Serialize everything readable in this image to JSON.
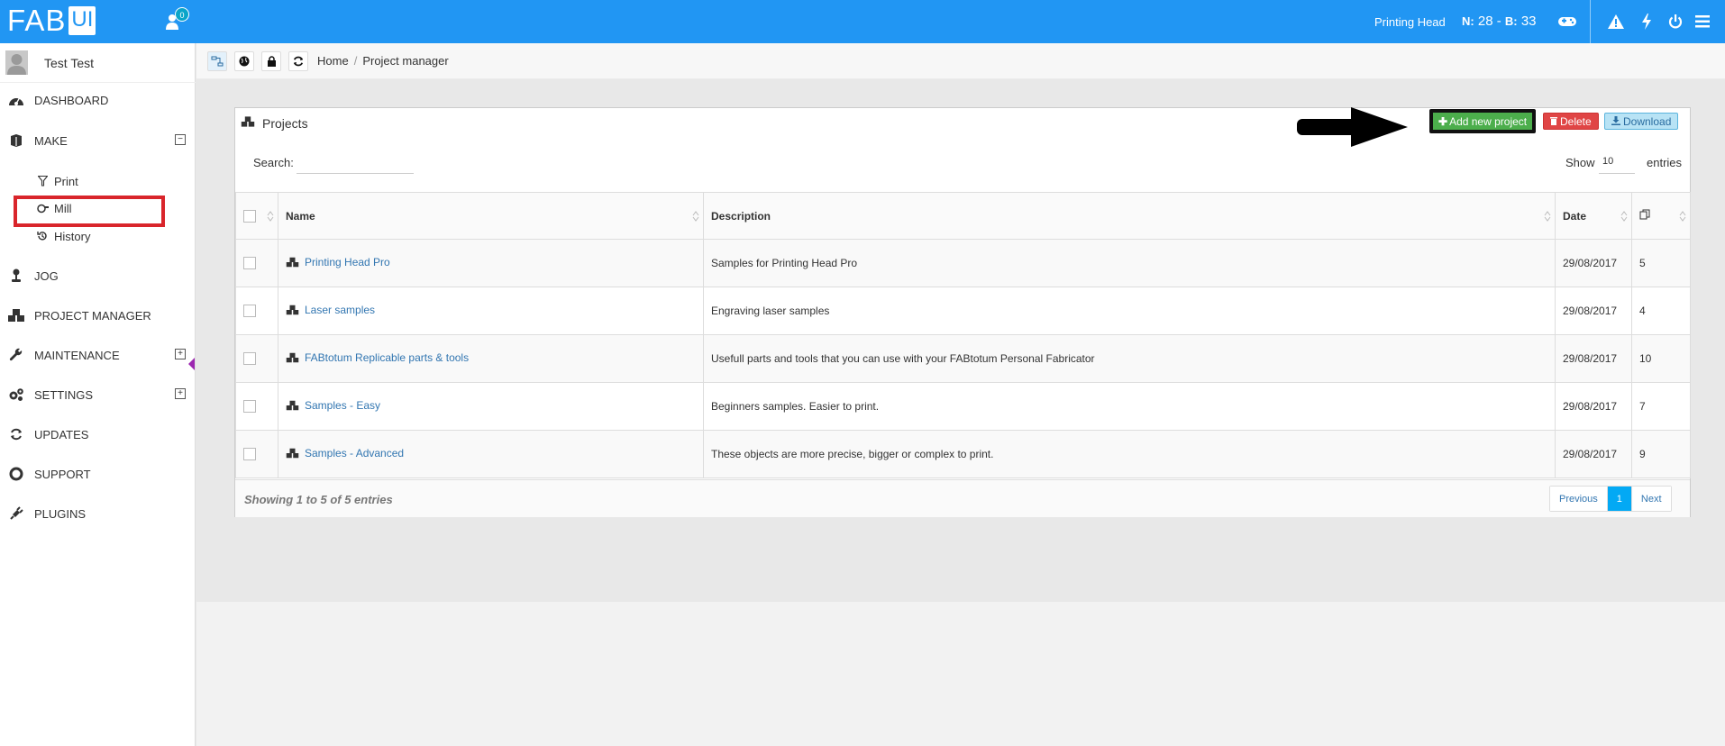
{
  "app": {
    "logo_main": "FAB",
    "logo_sub": "UI",
    "notifications_count": "0",
    "head_status": "Printing Head",
    "temps": {
      "nozzle_label": "N:",
      "nozzle_value": "28",
      "bed_sep": "-",
      "bed_label": "B:",
      "bed_value": "33"
    }
  },
  "sidebar": {
    "user_name": "Test Test",
    "items": [
      {
        "label": "DASHBOARD",
        "icon": "dashboard-icon"
      },
      {
        "label": "MAKE",
        "icon": "make-icon",
        "toggle": "−"
      },
      {
        "label": "JOG",
        "icon": "jog-icon"
      },
      {
        "label": "PROJECT MANAGER",
        "icon": "project-manager-icon"
      },
      {
        "label": "MAINTENANCE",
        "icon": "wrench-icon",
        "toggle": "+"
      },
      {
        "label": "SETTINGS",
        "icon": "gears-icon",
        "toggle": "+"
      },
      {
        "label": "UPDATES",
        "icon": "refresh-icon"
      },
      {
        "label": "SUPPORT",
        "icon": "lifebuoy-icon"
      },
      {
        "label": "PLUGINS",
        "icon": "plug-icon"
      }
    ],
    "make_sub": [
      {
        "label": "Print",
        "icon": "filter-icon"
      },
      {
        "label": "Mill",
        "icon": "mill-icon"
      },
      {
        "label": "History",
        "icon": "history-icon"
      }
    ]
  },
  "breadcrumb": {
    "home": "Home",
    "sep": "/",
    "current": "Project manager"
  },
  "panel": {
    "title": "Projects",
    "add_label": "Add new project",
    "delete_label": "Delete",
    "download_label": "Download",
    "search_label": "Search:",
    "search_value": "",
    "show_label": "Show",
    "show_value": "10",
    "entries_label": "entries",
    "columns": {
      "name": "Name",
      "description": "Description",
      "date": "Date"
    },
    "rows": [
      {
        "name": "Printing Head Pro",
        "description": "Samples for Printing Head Pro",
        "date": "29/08/2017",
        "count": "5"
      },
      {
        "name": "Laser samples",
        "description": "Engraving laser samples",
        "date": "29/08/2017",
        "count": "4"
      },
      {
        "name": "FABtotum Replicable parts & tools",
        "description": "Usefull parts and tools that you can use with your FABtotum Personal Fabricator",
        "date": "29/08/2017",
        "count": "10"
      },
      {
        "name": "Samples - Easy",
        "description": "Beginners samples. Easier to print.",
        "date": "29/08/2017",
        "count": "7"
      },
      {
        "name": "Samples - Advanced",
        "description": "These objects are more precise, bigger or complex to print.",
        "date": "29/08/2017",
        "count": "9"
      }
    ],
    "footer_info": "Showing 1 to 5 of 5 entries",
    "pager": {
      "prev": "Previous",
      "page": "1",
      "next": "Next"
    }
  },
  "colors": {
    "topbar": "#2196f3",
    "add": "#4cae4c",
    "delete": "#e04545",
    "download_bg": "#b8e3f5",
    "highlight": "#d9252b"
  }
}
